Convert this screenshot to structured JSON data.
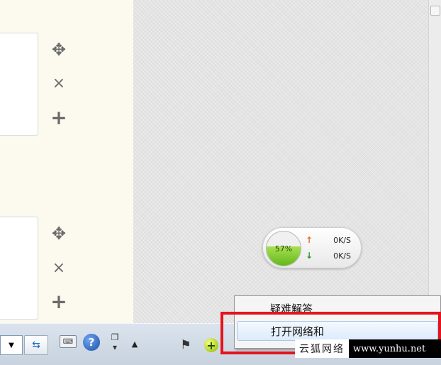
{
  "widget_controls": {
    "move_glyph": "✥",
    "close_glyph": "×",
    "add_glyph": "+"
  },
  "network_monitor": {
    "usage_label": "57%",
    "usage_fraction": 0.57,
    "upload_speed": "0K/S",
    "download_speed": "0K/S",
    "upload_arrow": "↑",
    "download_arrow": "↓",
    "fill_color": "#7bc82e"
  },
  "context_menu": {
    "items": [
      {
        "label": "疑难解答"
      },
      {
        "label": "打开网络和"
      }
    ]
  },
  "taskbar": {
    "combo_arrow": "▼",
    "lang_glyph": "⇆",
    "keyboard_glyph": "⌨",
    "help_glyph": "?",
    "restore_glyph": "❐",
    "restore_down_glyph": "▾",
    "show_hidden_glyph": "▲",
    "flag_glyph": "⚑",
    "add_glyph": "+"
  },
  "watermark": {
    "cn": "云狐网络",
    "url": "www.yunhu.net"
  },
  "colors": {
    "highlight": "#e3141c",
    "desktop_bg": "#e4e4e4",
    "panel_bg": "#fcfaee"
  }
}
